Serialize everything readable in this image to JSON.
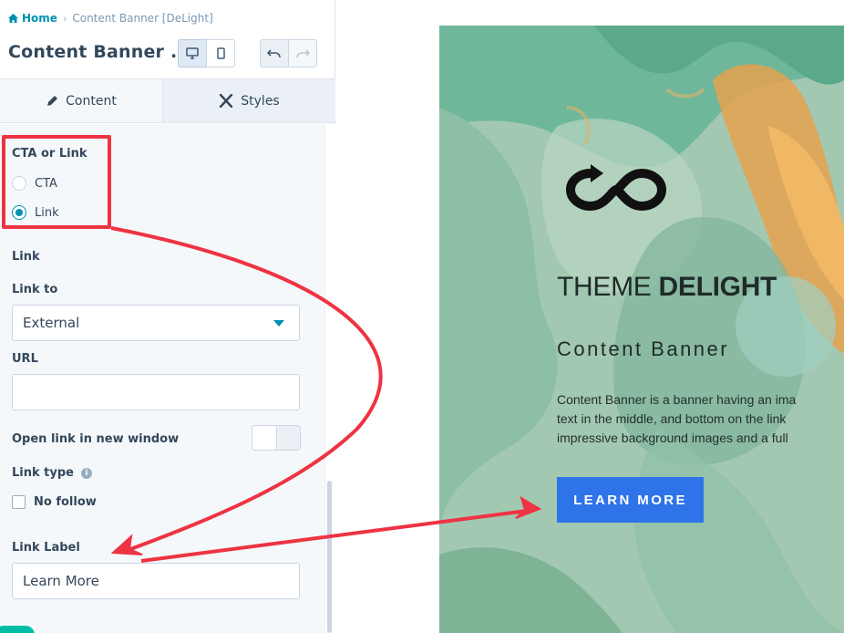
{
  "breadcrumb": {
    "home": "Home",
    "current": "Content Banner [DeLight]"
  },
  "editor": {
    "title": "Content Banner ..."
  },
  "tabs": [
    {
      "label": "Content"
    },
    {
      "label": "Styles"
    }
  ],
  "form": {
    "cta_group_label": "CTA or Link",
    "options": [
      {
        "label": "CTA",
        "selected": false
      },
      {
        "label": "Link",
        "selected": true
      }
    ],
    "link_section": "Link",
    "link_to_label": "Link to",
    "link_to_value": "External",
    "url_label": "URL",
    "url_value": "",
    "new_window_label": "Open link in new window",
    "new_window_on": false,
    "link_type_label": "Link type",
    "no_follow_label": "No follow",
    "no_follow_checked": false,
    "link_label_label": "Link Label",
    "link_label_value": "Learn More"
  },
  "preview": {
    "brand_light": "THEME ",
    "brand_bold": "DELIGHT",
    "heading": "Content Banner",
    "body_lines": [
      "Content Banner is a banner having an ima",
      "text in the middle, and bottom on the link",
      "impressive background images and a full"
    ],
    "button_label": "LEARN MORE"
  },
  "colors": {
    "accent": "#0091ae",
    "annotation": "#ee3342",
    "cta": "#2e73e8"
  },
  "icons": [
    "home-icon",
    "desktop-icon",
    "mobile-icon",
    "undo-icon",
    "redo-icon",
    "pencil-icon",
    "styles-icon",
    "info-icon",
    "infinity-logo"
  ]
}
